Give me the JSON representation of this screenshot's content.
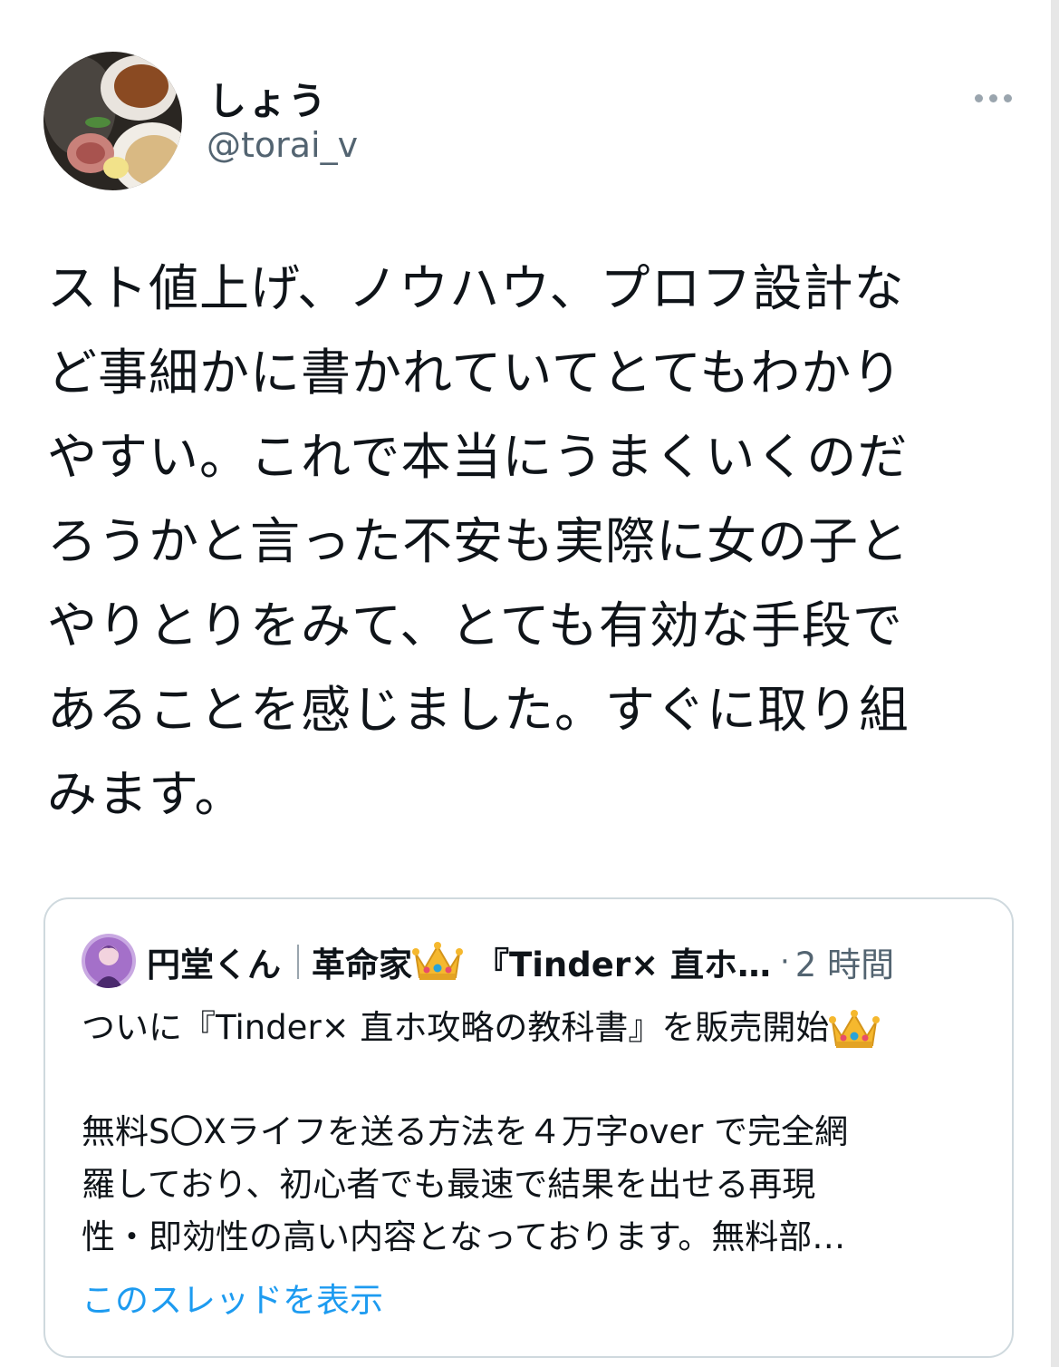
{
  "author": {
    "display_name": "しょう",
    "handle": "@torai_v",
    "avatar_icon": "food-photo-avatar"
  },
  "more_icon": "more-dots-icon",
  "tweet_text": "スト値上げ、ノウハウ、プロフ設計な\nど事細かに書かれていてとてもわかり\nやすい。これで本当にうまくいくのだ\nろうかと言った不安も実際に女の子と\nやりとりをみて、とても有効な手段で\nあることを感じました。すぐに取り組\nみます。",
  "quote": {
    "author_name": "円堂くん",
    "author_title": "革命家",
    "author_title_suffix": "『Tinder× 直ホ…",
    "crown_icon": "crown-emoji-icon",
    "dot": "·",
    "time": "2 時間",
    "first_line": "ついに『Tinder× 直ホ攻略の教科書』を販売開始",
    "body": "無料S〇Xライフを送る方法を４万字over で完全網\n羅しており、初心者でも最速で結果を出せる再現\n性・即効性の高い内容となっております。無料部…",
    "show_thread": "このスレッドを表示"
  },
  "colors": {
    "text": "#0f1419",
    "secondary": "#536471",
    "link": "#1d9bf0",
    "border": "#cfd9de"
  }
}
